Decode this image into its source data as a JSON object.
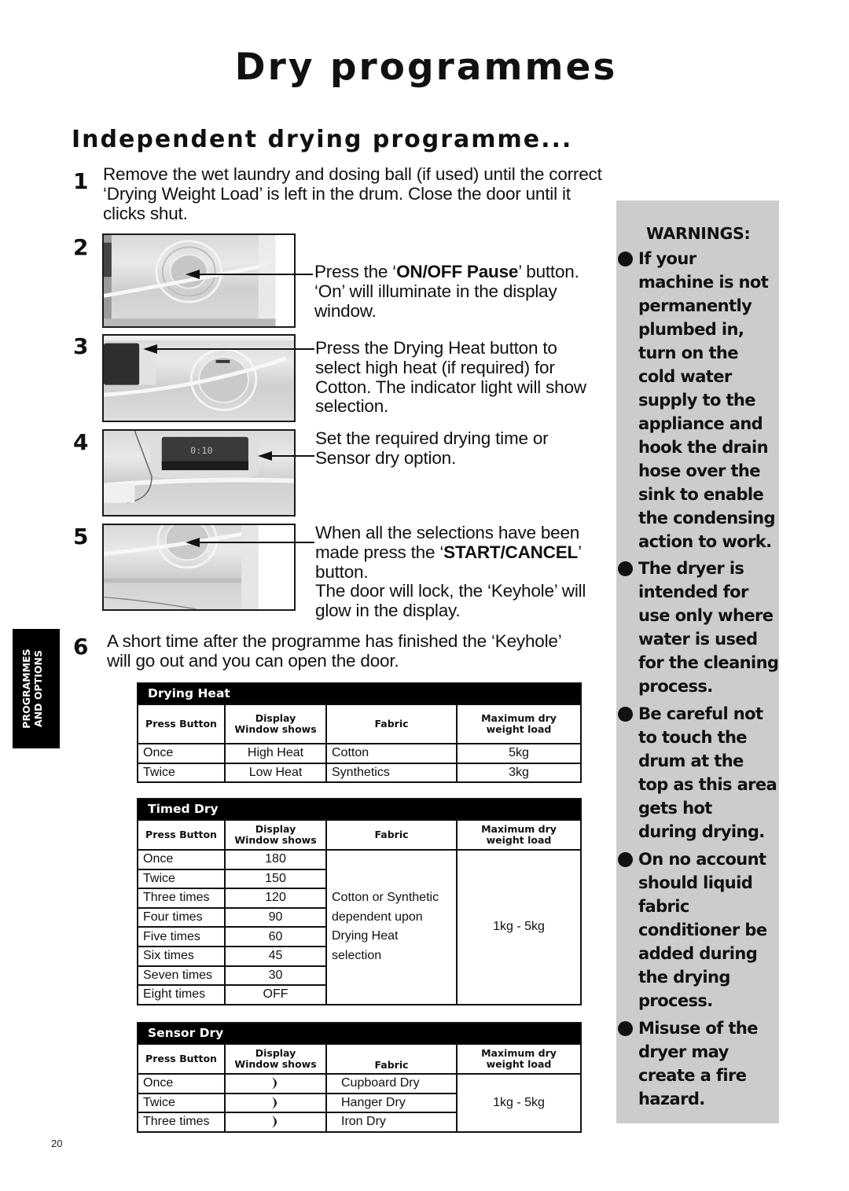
{
  "page": {
    "title": "Dry programmes",
    "section_title": "Independent drying programme...",
    "page_number": "20",
    "side_tab": "PROGRAMMES\nAND OPTIONS"
  },
  "steps": [
    {
      "number": "1",
      "text": "Remove the wet laundry and dosing ball (if used) until the correct ‘Drying Weight Load’ is left in the drum. Close the door until it clicks shut."
    },
    {
      "number": "2",
      "text_before": "Press the ‘",
      "text_bold": "ON/OFF Pause",
      "text_after": "’ button. ‘On’ will illuminate in the display window.",
      "image": "dryer-control-panel-dial"
    },
    {
      "number": "3",
      "text": "Press the Drying Heat button to select high heat (if required) for Cotton. The indicator light will show selection.",
      "image": "dryer-control-panel-display-left"
    },
    {
      "number": "4",
      "text": "Set the required drying time or Sensor dry option.",
      "image": "dryer-display-window"
    },
    {
      "number": "5",
      "text_before": "When all the selections have been made press the ‘",
      "text_bold": "START/CANCEL",
      "text_after": "’ button.",
      "text_extra": "The door will lock, the ‘Keyhole’ will glow in the display.",
      "image": "dryer-control-panel-start"
    },
    {
      "number": "6",
      "text": "A short time after the programme has finished the ‘Keyhole’ will go out and you can open the door."
    }
  ],
  "tables": {
    "headers": [
      "Press Button",
      "Display\nWindow shows",
      "Fabric",
      "Maximum dry\nweight load"
    ],
    "drying_heat": {
      "title": "Drying Heat",
      "rows": [
        [
          "Once",
          "High Heat",
          "Cotton",
          "5kg"
        ],
        [
          "Twice",
          "Low Heat",
          "Synthetics",
          "3kg"
        ]
      ]
    },
    "timed_dry": {
      "title": "Timed Dry",
      "rows": [
        [
          "Once",
          "180"
        ],
        [
          "Twice",
          "150"
        ],
        [
          "Three times",
          "120"
        ],
        [
          "Four times",
          "90"
        ],
        [
          "Five times",
          "60"
        ],
        [
          "Six times",
          "45"
        ],
        [
          "Seven times",
          "30"
        ],
        [
          "Eight times",
          "OFF"
        ]
      ],
      "fabric_lines": [
        "Cotton or Synthetic",
        "dependent upon",
        "Drying Heat",
        "selection"
      ],
      "max_load": "1kg - 5kg"
    },
    "sensor_dry": {
      "title": "Sensor Dry",
      "rows": [
        [
          "Once",
          "crescent-moon-icon",
          "Cupboard Dry"
        ],
        [
          "Twice",
          "crescent-moon-icon",
          "Hanger Dry"
        ],
        [
          "Three times",
          "crescent-moon-icon",
          "Iron Dry"
        ]
      ],
      "max_load": "1kg - 5kg"
    }
  },
  "warnings": {
    "title": "WARNINGS:",
    "items": [
      "If your\nmachine is not\npermanently\nplumbed in,\nturn on the\ncold water\nsupply to the\nappliance and\nhook the drain\nhose over the\nsink to enable\nthe condensing\naction to work.",
      "The dryer is\nintended for\nuse only where\nwater is used\nfor the cleaning\nprocess.",
      "Be careful not\nto touch the\ndrum at the\ntop as this area\ngets hot\nduring drying.",
      "On no account\nshould liquid\nfabric\nconditioner be\nadded during\nthe drying\nprocess.",
      "Misuse of the\ndryer may\ncreate a fire\nhazard."
    ]
  }
}
